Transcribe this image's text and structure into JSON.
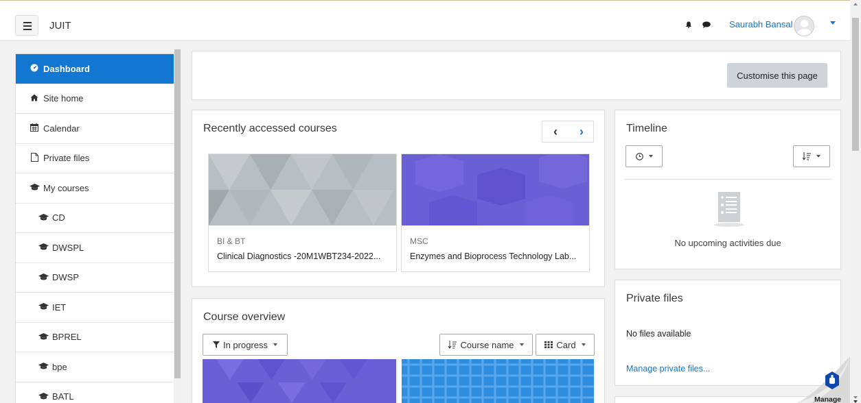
{
  "header": {
    "brand": "JUIT",
    "username": "Saurabh Bansal",
    "icons": [
      "menu-icon",
      "bell-icon",
      "chat-icon",
      "avatar",
      "chevron-down-icon"
    ]
  },
  "sidebar": {
    "items": [
      {
        "label": "Dashboard",
        "icon": "dashboard-icon",
        "active": true
      },
      {
        "label": "Site home",
        "icon": "home-icon"
      },
      {
        "label": "Calendar",
        "icon": "calendar-icon"
      },
      {
        "label": "Private files",
        "icon": "file-icon"
      },
      {
        "label": "My courses",
        "icon": "graduation-cap-icon"
      },
      {
        "label": "CD",
        "icon": "graduation-cap-icon"
      },
      {
        "label": "DWSPL",
        "icon": "graduation-cap-icon"
      },
      {
        "label": "DWSP",
        "icon": "graduation-cap-icon"
      },
      {
        "label": "IET",
        "icon": "graduation-cap-icon"
      },
      {
        "label": "BPREL",
        "icon": "graduation-cap-icon"
      },
      {
        "label": "bpe",
        "icon": "graduation-cap-icon"
      },
      {
        "label": "BATL",
        "icon": "graduation-cap-icon"
      }
    ]
  },
  "main": {
    "customise_label": "Customise this page",
    "recent": {
      "title": "Recently accessed courses",
      "courses": [
        {
          "category": "BI & BT",
          "name": "Clinical Diagnostics -20M1WBT234-2022...",
          "color": "#b7bfc4"
        },
        {
          "category": "MSC",
          "name": "Enzymes and Bioprocess Technology Lab...",
          "color": "#6b5fd6"
        }
      ]
    },
    "overview": {
      "title": "Course overview",
      "filter_label": "In progress",
      "sort_label": "Course name",
      "view_label": "Card"
    },
    "timeline": {
      "title": "Timeline",
      "empty_text": "No upcoming activities due"
    },
    "private_files": {
      "title": "Private files",
      "empty_text": "No files available",
      "manage_link": "Manage private files..."
    },
    "manage_badge": "Manage"
  },
  "colors": {
    "accent": "#1177d1",
    "purple": "#6b5fd6",
    "blue": "#2f8de0"
  }
}
